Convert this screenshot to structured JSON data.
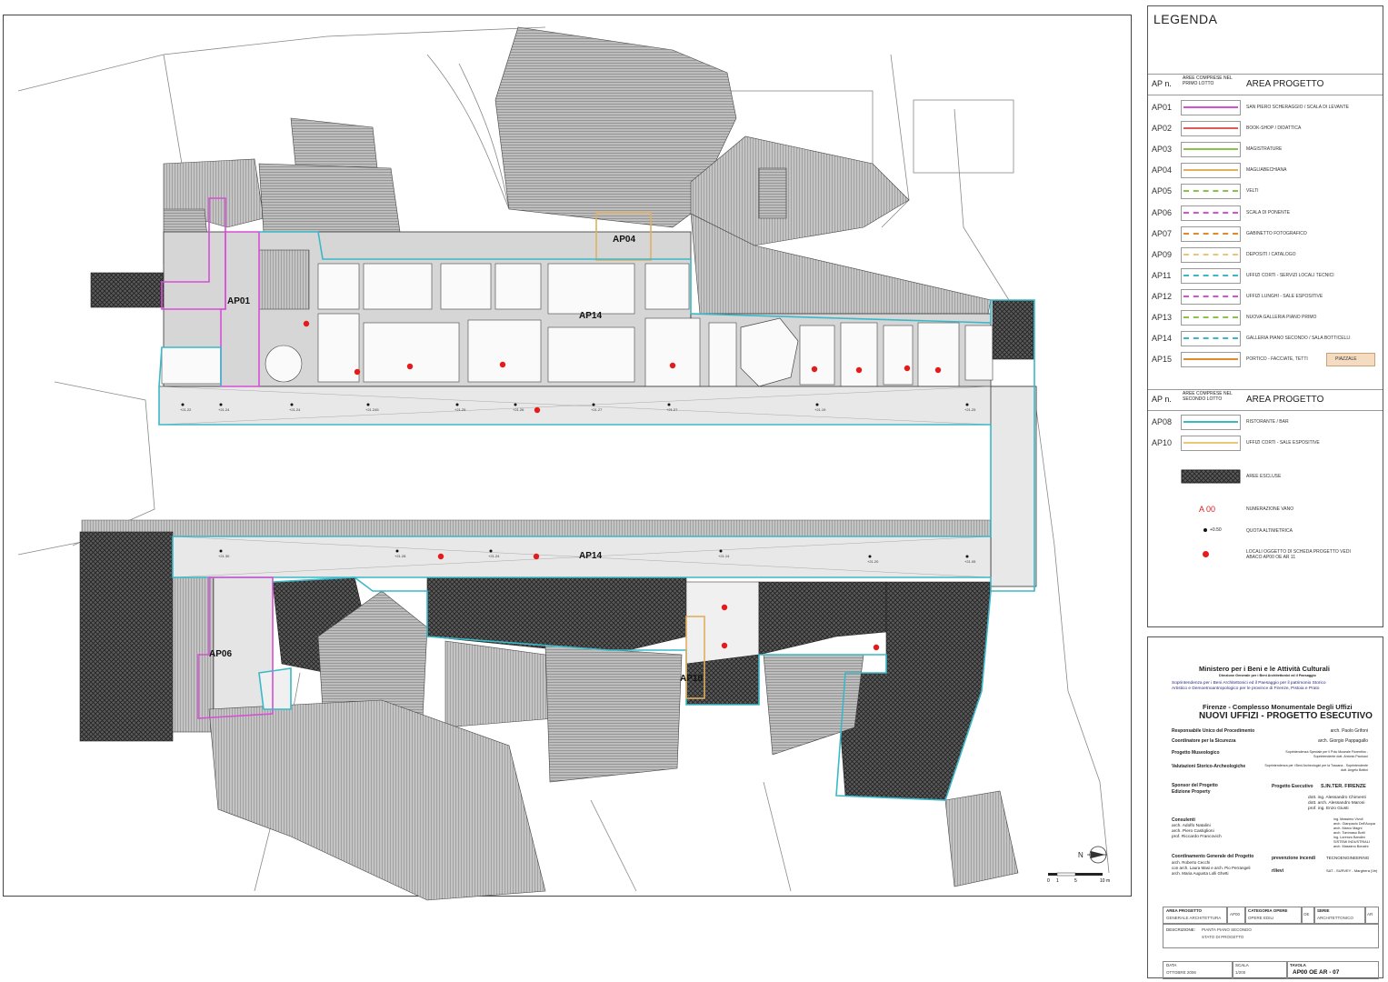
{
  "legend": {
    "title": "LEGENDA",
    "first_lot_header": {
      "code": "AP n.",
      "included": "AREE COMPRESE NEL PRIMO LOTTO",
      "area": "AREA PROGETTO"
    },
    "first_lot": [
      {
        "code": "AP01",
        "label": "SAN PIERO SCHERAGGIO / SCALA DI LEVANTE",
        "color": "#d64fd6",
        "style": "solid"
      },
      {
        "code": "AP02",
        "label": "BOOK-SHOP / DIDATTICA",
        "color": "#e05a5a",
        "style": "solid"
      },
      {
        "code": "AP03",
        "label": "MAGISTRATURE",
        "color": "#8bc34a",
        "style": "solid"
      },
      {
        "code": "AP04",
        "label": "MAGLIABECHIANA",
        "color": "#e0b060",
        "style": "solid"
      },
      {
        "code": "AP05",
        "label": "VELTI",
        "color": "#8bc34a",
        "style": "dashed"
      },
      {
        "code": "AP06",
        "label": "SCALA DI PONENTE",
        "color": "#d64fd6",
        "style": "dashed"
      },
      {
        "code": "AP07",
        "label": "GABINETTO FOTOGRAFICO",
        "color": "#e08a2a",
        "style": "dashed"
      },
      {
        "code": "AP09",
        "label": "DEPOSITI / CATALOGO",
        "color": "#e8c878",
        "style": "dashed"
      },
      {
        "code": "AP11",
        "label": "UFFIZI CORTI - SERVIZI LOCALI TECNICI",
        "color": "#3ab8c8",
        "style": "dashed"
      },
      {
        "code": "AP12",
        "label": "UFFIZI LUNGHI - SALE ESPOSITIVE",
        "color": "#d64fd6",
        "style": "dashdot"
      },
      {
        "code": "AP13",
        "label": "NUOVA GALLERIA PIANO PRIMO",
        "color": "#8bc34a",
        "style": "dashdot"
      },
      {
        "code": "AP14",
        "label": "GALLERIA PIANO SECONDO / SALA BOTTICELLI",
        "color": "#3ab8c8",
        "style": "dashdot"
      },
      {
        "code": "AP15",
        "label": "PORTICO - FACCIATE, TETTI",
        "color": "#e08a2a",
        "style": "solid",
        "extra": "PIAZZALE"
      }
    ],
    "second_lot_header": {
      "code": "AP n.",
      "included": "AREE COMPRESE NEL SECONDO LOTTO",
      "area": "AREA PROGETTO"
    },
    "second_lot": [
      {
        "code": "AP08",
        "label": "RISTORANTE / BAR",
        "color": "#3ab8c8",
        "style": "solid"
      },
      {
        "code": "AP10",
        "label": "UFFIZI CORTI - SALE ESPOSITIVE",
        "color": "#e8c878",
        "style": "solid"
      }
    ],
    "symbols": {
      "excluded": "AREE ESCLUSE",
      "room_number_sample": "A 00",
      "room_number": "NUMERAZIONE VANO",
      "elevation_sample": "+0.50",
      "elevation": "QUOTA ALTIMETRICA",
      "rooms_card": "LOCALI OGGETTO DI SCHEDA PROGETTO VEDI ABACO AP00 OE AR 11"
    }
  },
  "plan": {
    "area_labels": [
      "AP04",
      "AP01",
      "AP14",
      "AP14",
      "AP06",
      "AP10"
    ],
    "north": "N",
    "scale": [
      "0",
      "1",
      "5",
      "10 m"
    ],
    "elevations_top": [
      "+21.22",
      "+21.24",
      "+21.24",
      "+21.245",
      "+21.25",
      "+21.26",
      "+21.27",
      "+21.27",
      "+21.19",
      "+21.25"
    ],
    "elevations_bottom": [
      "+21.30",
      "+21.28",
      "+21.24",
      "+21.14",
      "+21.20",
      "+21.05"
    ]
  },
  "title_block": {
    "ministry": "Ministero per i Beni e le Attività Culturali",
    "directorate": "Direzione Generale per i Beni Architettonici ed il Paesaggio",
    "superintendency1": "Soprintendenza per i Beni Architettonici ed il Paesaggio per il patrimonio Storico",
    "superintendency2": "Artistico e Demoetnoantropologico per le province di Firenze, Pistoia e Prato",
    "complex": "Firenze - Complesso Monumentale Degli Uffizi",
    "project": "NUOVI UFFIZI - PROGETTO ESECUTIVO",
    "people": [
      {
        "role": "Responsabile Unico del Procedimento",
        "name": "arch. Paolo Grifoni"
      },
      {
        "role": "Coordinatore per la Sicurezza",
        "name": "arch. Giorgio Pappagallo"
      },
      {
        "role": "Progetto Museologico",
        "name": "Soprintendenza Speciale per il Polo Museale Fiorentino - Soprintendente dott. Antonio Paolucci"
      },
      {
        "role": "Valutazioni Storico-Archeologiche",
        "name": "Soprintendenza per i Beni Archeologici per la Toscana - Soprintendente dott. Angelo Bottini"
      }
    ],
    "sponsor_label": "Sponsor del Progetto",
    "sponsor": "Edizione Property",
    "executive_label": "Progetto Esecutivo",
    "executive": "S.IN.TER. FIRENZE",
    "structures": [
      "dott. ing. Alessandro Chimenti",
      "dott. arch. Alessandro Maroni",
      "prof. ing. Enzo Giusti"
    ],
    "plants": [
      "ing. Massimo Vivoli",
      "arch. Gianpaolo Dell'Acqua",
      "arch. Marco Magni",
      "arch. Tommaso Botti",
      "ing. Lorenzo Bandini",
      "SISTEMI INDUSTRIALI",
      "arch. Massimo Bonaini"
    ],
    "consultants_label": "Consulenti",
    "consultants": [
      "arch. Adolfo Natalini",
      "arch. Piero Castiglioni",
      "prof. Riccardo Francovich"
    ],
    "coordination_label": "Coordinamento Generale del Progetto",
    "coordination": [
      "arch. Roberto Cecchi",
      "con arch. Laura Masi e arch. Pio Perrangeli",
      "arch. Maria Augusta Lolli Ghetti"
    ],
    "fire_label": "prevenzione incendi",
    "fire": "TECNOENGINEERING",
    "survey_label": "rilievi",
    "survey": "SAT - SURVEY - Marghera (Ve)",
    "cells": {
      "area_label": "AREA PROGETTO",
      "area_val": "GENERALE ARCHITETTURA",
      "area_code": "AP00",
      "cat_label": "CATEGORIA OPERE",
      "cat_val": "OPERE EDILI",
      "cat_code": "OE",
      "series_label": "SERIE",
      "series_val": "ARCHITETTONICO",
      "series_code": "AR",
      "desc_label": "DESCRIZIONE:",
      "desc_val": "PIANTA PIANO SECONDO",
      "desc_val2": "STATO DI PROGETTO",
      "date_label": "DATA",
      "date_val": "OTTOBRE 2006",
      "scale_label": "SCALA",
      "scale_val": "1/200",
      "table_label": "TAVOLA",
      "table_val": "AP00 OE AR - 07"
    }
  }
}
